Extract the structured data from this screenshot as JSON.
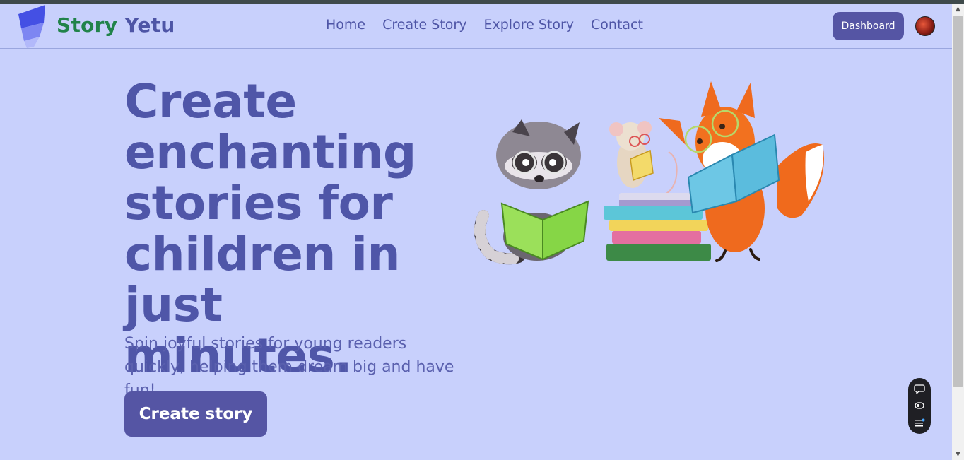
{
  "brand": {
    "word1": "Story",
    "word2": "Yetu"
  },
  "nav": {
    "links": [
      "Home",
      "Create Story",
      "Explore Story",
      "Contact"
    ]
  },
  "header": {
    "dashboard_label": "Dashboard",
    "avatar": "user-avatar"
  },
  "hero": {
    "title": "Create enchanting stories for children in just minutes.",
    "subtitle": "Spin joyful stories for young readers quickly, helping them dream big and have fun!",
    "cta_label": "Create story",
    "illustration": "raccoon-mouse-fox-reading-books"
  },
  "widget": {
    "icons": [
      "chat-icon",
      "toggle-icon",
      "list-icon"
    ]
  },
  "colors": {
    "background": "#c8d0fc",
    "primary": "#5555a4",
    "text": "#4f56a8",
    "brand_green": "#21834a"
  }
}
